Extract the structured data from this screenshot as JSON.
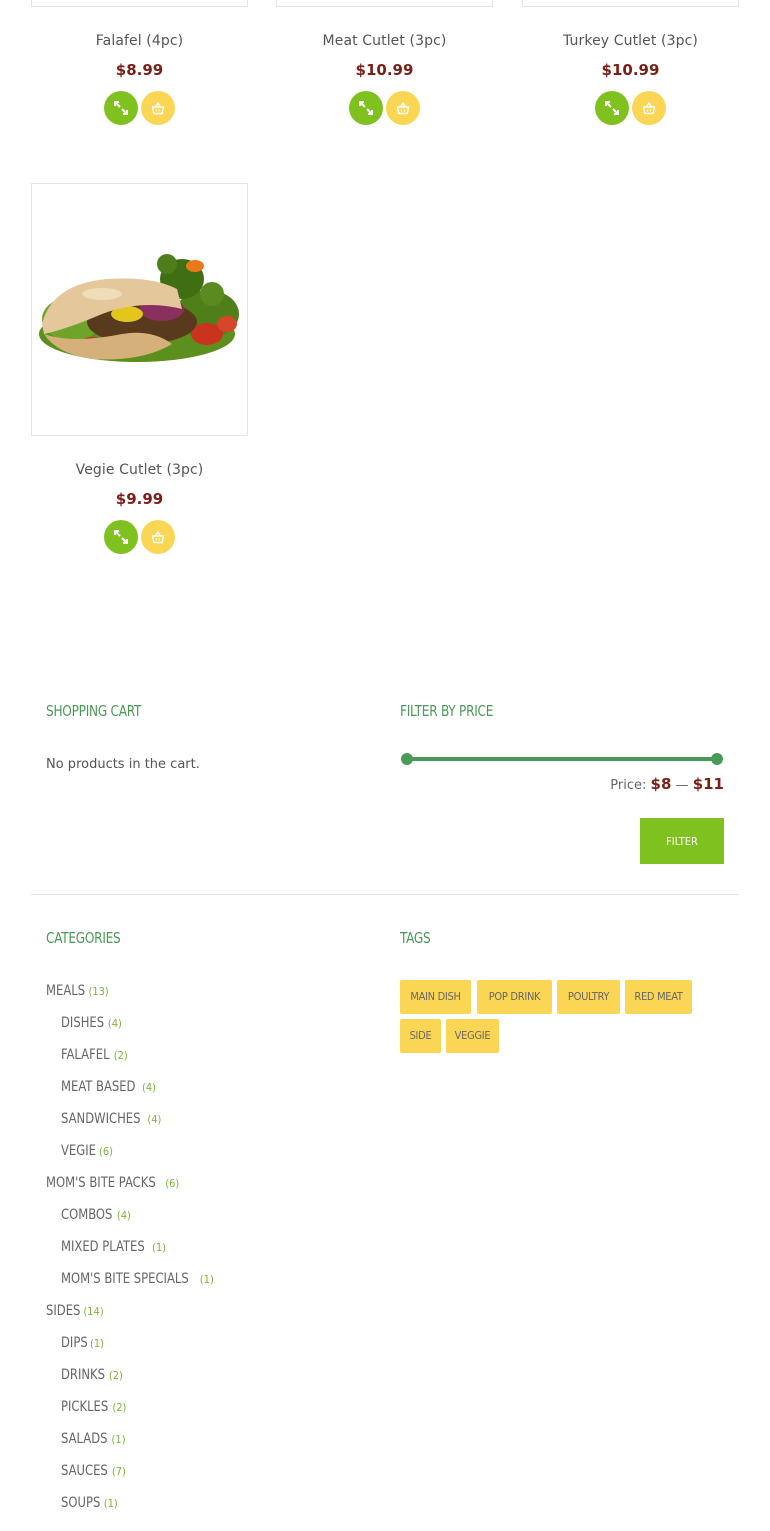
{
  "products": [
    {
      "name": "Falafel (4pc)",
      "price": "$8.99"
    },
    {
      "name": "Meat Cutlet (3pc)",
      "price": "$10.99"
    },
    {
      "name": "Turkey Cutlet (3pc)",
      "price": "$10.99"
    },
    {
      "name": "Vegie Cutlet (3pc)",
      "price": "$9.99"
    }
  ],
  "product_icons": {
    "quick_view": "expand-icon",
    "add_to_cart": "basket-icon"
  },
  "shopping_cart": {
    "title": "SHOPPING CART",
    "empty_text": "No products in the cart."
  },
  "filter_by_price": {
    "title": "FILTER BY PRICE",
    "price_prefix": "Price:",
    "min": "$8",
    "separator": "—",
    "max": "$11",
    "button": "FILTER"
  },
  "categories": {
    "title": "CATEGORIES",
    "items": [
      {
        "name": "MEALS",
        "count": "(13)",
        "level": 0
      },
      {
        "name": "DISHES",
        "count": "(4)",
        "level": 1
      },
      {
        "name": "FALAFEL",
        "count": "(2)",
        "level": 1
      },
      {
        "name": "MEAT BASED",
        "count": "(4)",
        "level": 1
      },
      {
        "name": "SANDWICHES",
        "count": "(4)",
        "level": 1
      },
      {
        "name": "VEGIE",
        "count": "(6)",
        "level": 1
      },
      {
        "name": "MOM'S BITE PACKS",
        "count": "(6)",
        "level": 0
      },
      {
        "name": "COMBOS",
        "count": "(4)",
        "level": 1
      },
      {
        "name": "MIXED PLATES",
        "count": "(1)",
        "level": 1
      },
      {
        "name": "MOM'S BITE SPECIALS",
        "count": "(1)",
        "level": 1
      },
      {
        "name": "SIDES",
        "count": "(14)",
        "level": 0
      },
      {
        "name": "DIPS",
        "count": "(1)",
        "level": 1
      },
      {
        "name": "DRINKS",
        "count": "(2)",
        "level": 1
      },
      {
        "name": "PICKLES",
        "count": "(2)",
        "level": 1
      },
      {
        "name": "SALADS",
        "count": "(1)",
        "level": 1
      },
      {
        "name": "SAUCES",
        "count": "(7)",
        "level": 1
      },
      {
        "name": "SOUPS",
        "count": "(1)",
        "level": 1
      }
    ]
  },
  "tags": {
    "title": "TAGS",
    "items": [
      "MAIN DISH",
      "POP DRINK",
      "POULTRY",
      "RED MEAT",
      "SIDE",
      "VEGGIE"
    ]
  },
  "colors": {
    "green": "#7fc220",
    "yellow": "#fbd655",
    "title_green": "#4a9a57",
    "price_red": "#7a1e16"
  }
}
